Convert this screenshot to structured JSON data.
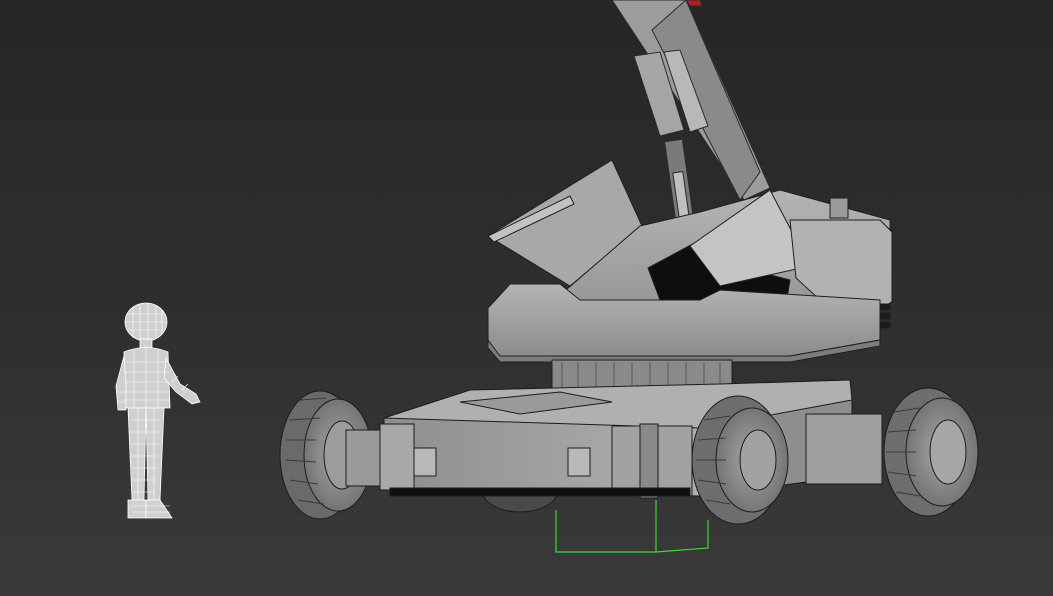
{
  "viewport": {
    "background_top": "#262626",
    "background_bottom": "#3a3a3a"
  },
  "scene": {
    "crane_color": "#9a9a9a",
    "crane_shadow": "#6e6e6e",
    "crane_dark": "#101010",
    "wire_color": "#2c2c2c",
    "human_wire_color": "#ffffff",
    "selection_color": "#39d83b"
  }
}
